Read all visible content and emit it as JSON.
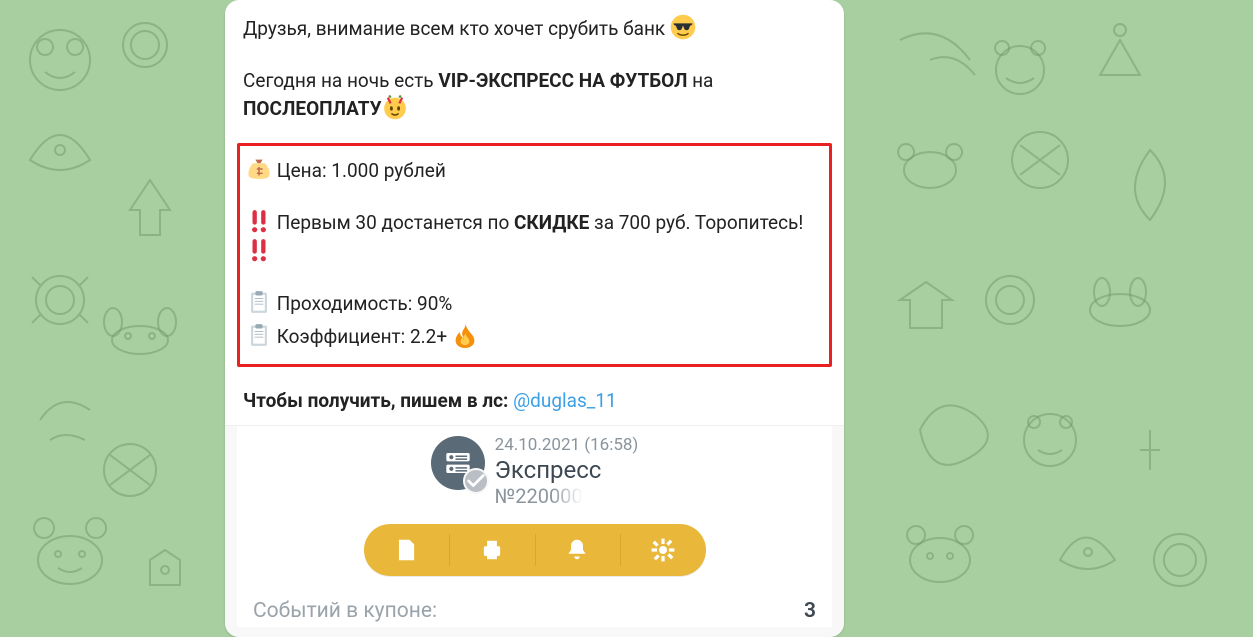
{
  "message": {
    "intro_line": "Друзья, внимание всем кто хочет срубить банк ",
    "line2_prefix": "Сегодня на ночь есть ",
    "line2_bold1": "VIP-ЭКСПРЕСС НА ФУТБОЛ",
    "line2_mid": "  на ",
    "line2_bold2": "ПОСЛЕОПЛАТУ",
    "price_line": " Цена: 1.000 рублей",
    "discount_pre": " Первым 30 достанется по ",
    "discount_bold": "СКИДКЕ",
    "discount_post": " за 700 руб. Торопитесь! ",
    "pass_line": " Проходимость: 90%",
    "coef_line": " Коэффициент: 2.2+ ",
    "cta_pre": "Чтобы получить, пишем в лс: ",
    "cta_link": "@duglas_11"
  },
  "attachment": {
    "date": "24.10.2021 (16:58)",
    "title": "Экспресс",
    "number_prefix": "№22",
    "events_label": "Событий в купоне:",
    "events_count": "3"
  }
}
